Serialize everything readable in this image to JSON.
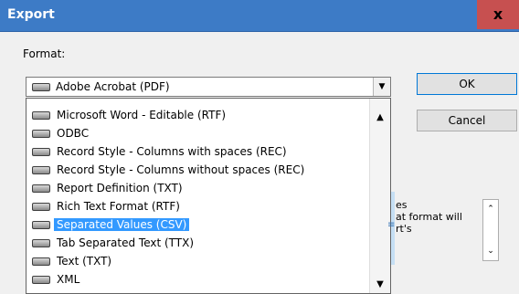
{
  "window": {
    "title": "Export",
    "close_glyph": "x"
  },
  "format": {
    "label": "Format:",
    "selected": "Adobe Acrobat (PDF)",
    "options": [
      {
        "label": "Microsoft Word - Editable (RTF)",
        "selected": false
      },
      {
        "label": "ODBC",
        "selected": false
      },
      {
        "label": "Record Style - Columns with spaces (REC)",
        "selected": false
      },
      {
        "label": "Record Style - Columns without spaces (REC)",
        "selected": false
      },
      {
        "label": "Report Definition (TXT)",
        "selected": false
      },
      {
        "label": "Rich Text Format (RTF)",
        "selected": false
      },
      {
        "label": "Separated Values (CSV)",
        "selected": true
      },
      {
        "label": "Tab Separated Text (TTX)",
        "selected": false
      },
      {
        "label": "Text (TXT)",
        "selected": false
      },
      {
        "label": "XML",
        "selected": false
      }
    ]
  },
  "buttons": {
    "ok": "OK",
    "cancel": "Cancel"
  },
  "description": {
    "lines": [
      "es",
      "at format will",
      "rt's"
    ]
  },
  "icons": {
    "format_icon": "drive-icon",
    "combo_arrow": "chevron-down-icon",
    "scroll_up": "chevron-up-icon",
    "scroll_down": "chevron-down-icon",
    "grip": "splitter-grip-icon"
  },
  "colors": {
    "title_bar": "#3d7bc6",
    "close_button": "#c75050",
    "selection": "#3399ff"
  }
}
